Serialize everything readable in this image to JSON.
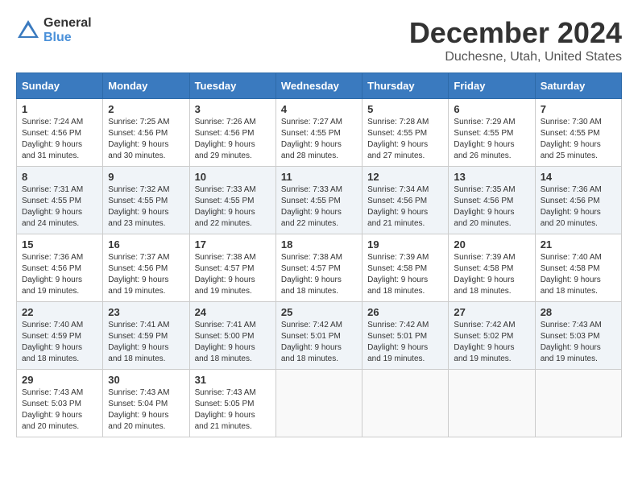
{
  "header": {
    "logo_general": "General",
    "logo_blue": "Blue",
    "month_title": "December 2024",
    "location": "Duchesne, Utah, United States"
  },
  "weekdays": [
    "Sunday",
    "Monday",
    "Tuesday",
    "Wednesday",
    "Thursday",
    "Friday",
    "Saturday"
  ],
  "weeks": [
    [
      {
        "day": "1",
        "info": "Sunrise: 7:24 AM\nSunset: 4:56 PM\nDaylight: 9 hours\nand 31 minutes."
      },
      {
        "day": "2",
        "info": "Sunrise: 7:25 AM\nSunset: 4:56 PM\nDaylight: 9 hours\nand 30 minutes."
      },
      {
        "day": "3",
        "info": "Sunrise: 7:26 AM\nSunset: 4:56 PM\nDaylight: 9 hours\nand 29 minutes."
      },
      {
        "day": "4",
        "info": "Sunrise: 7:27 AM\nSunset: 4:55 PM\nDaylight: 9 hours\nand 28 minutes."
      },
      {
        "day": "5",
        "info": "Sunrise: 7:28 AM\nSunset: 4:55 PM\nDaylight: 9 hours\nand 27 minutes."
      },
      {
        "day": "6",
        "info": "Sunrise: 7:29 AM\nSunset: 4:55 PM\nDaylight: 9 hours\nand 26 minutes."
      },
      {
        "day": "7",
        "info": "Sunrise: 7:30 AM\nSunset: 4:55 PM\nDaylight: 9 hours\nand 25 minutes."
      }
    ],
    [
      {
        "day": "8",
        "info": "Sunrise: 7:31 AM\nSunset: 4:55 PM\nDaylight: 9 hours\nand 24 minutes."
      },
      {
        "day": "9",
        "info": "Sunrise: 7:32 AM\nSunset: 4:55 PM\nDaylight: 9 hours\nand 23 minutes."
      },
      {
        "day": "10",
        "info": "Sunrise: 7:33 AM\nSunset: 4:55 PM\nDaylight: 9 hours\nand 22 minutes."
      },
      {
        "day": "11",
        "info": "Sunrise: 7:33 AM\nSunset: 4:55 PM\nDaylight: 9 hours\nand 22 minutes."
      },
      {
        "day": "12",
        "info": "Sunrise: 7:34 AM\nSunset: 4:56 PM\nDaylight: 9 hours\nand 21 minutes."
      },
      {
        "day": "13",
        "info": "Sunrise: 7:35 AM\nSunset: 4:56 PM\nDaylight: 9 hours\nand 20 minutes."
      },
      {
        "day": "14",
        "info": "Sunrise: 7:36 AM\nSunset: 4:56 PM\nDaylight: 9 hours\nand 20 minutes."
      }
    ],
    [
      {
        "day": "15",
        "info": "Sunrise: 7:36 AM\nSunset: 4:56 PM\nDaylight: 9 hours\nand 19 minutes."
      },
      {
        "day": "16",
        "info": "Sunrise: 7:37 AM\nSunset: 4:56 PM\nDaylight: 9 hours\nand 19 minutes."
      },
      {
        "day": "17",
        "info": "Sunrise: 7:38 AM\nSunset: 4:57 PM\nDaylight: 9 hours\nand 19 minutes."
      },
      {
        "day": "18",
        "info": "Sunrise: 7:38 AM\nSunset: 4:57 PM\nDaylight: 9 hours\nand 18 minutes."
      },
      {
        "day": "19",
        "info": "Sunrise: 7:39 AM\nSunset: 4:58 PM\nDaylight: 9 hours\nand 18 minutes."
      },
      {
        "day": "20",
        "info": "Sunrise: 7:39 AM\nSunset: 4:58 PM\nDaylight: 9 hours\nand 18 minutes."
      },
      {
        "day": "21",
        "info": "Sunrise: 7:40 AM\nSunset: 4:58 PM\nDaylight: 9 hours\nand 18 minutes."
      }
    ],
    [
      {
        "day": "22",
        "info": "Sunrise: 7:40 AM\nSunset: 4:59 PM\nDaylight: 9 hours\nand 18 minutes."
      },
      {
        "day": "23",
        "info": "Sunrise: 7:41 AM\nSunset: 4:59 PM\nDaylight: 9 hours\nand 18 minutes."
      },
      {
        "day": "24",
        "info": "Sunrise: 7:41 AM\nSunset: 5:00 PM\nDaylight: 9 hours\nand 18 minutes."
      },
      {
        "day": "25",
        "info": "Sunrise: 7:42 AM\nSunset: 5:01 PM\nDaylight: 9 hours\nand 18 minutes."
      },
      {
        "day": "26",
        "info": "Sunrise: 7:42 AM\nSunset: 5:01 PM\nDaylight: 9 hours\nand 19 minutes."
      },
      {
        "day": "27",
        "info": "Sunrise: 7:42 AM\nSunset: 5:02 PM\nDaylight: 9 hours\nand 19 minutes."
      },
      {
        "day": "28",
        "info": "Sunrise: 7:43 AM\nSunset: 5:03 PM\nDaylight: 9 hours\nand 19 minutes."
      }
    ],
    [
      {
        "day": "29",
        "info": "Sunrise: 7:43 AM\nSunset: 5:03 PM\nDaylight: 9 hours\nand 20 minutes."
      },
      {
        "day": "30",
        "info": "Sunrise: 7:43 AM\nSunset: 5:04 PM\nDaylight: 9 hours\nand 20 minutes."
      },
      {
        "day": "31",
        "info": "Sunrise: 7:43 AM\nSunset: 5:05 PM\nDaylight: 9 hours\nand 21 minutes."
      },
      {
        "day": "",
        "info": ""
      },
      {
        "day": "",
        "info": ""
      },
      {
        "day": "",
        "info": ""
      },
      {
        "day": "",
        "info": ""
      }
    ]
  ]
}
